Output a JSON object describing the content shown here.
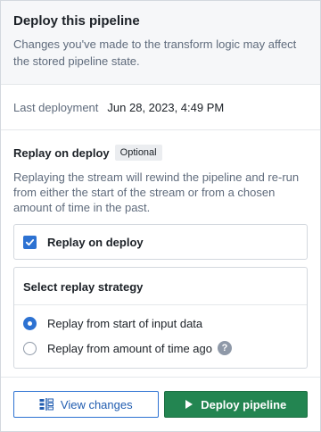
{
  "header": {
    "title": "Deploy this pipeline",
    "description": "Changes you've made to the transform logic may affect the stored pipeline state."
  },
  "last_deployment": {
    "label": "Last deployment",
    "value": "Jun 28, 2023, 4:49 PM"
  },
  "replay": {
    "title": "Replay on deploy",
    "tag": "Optional",
    "description": "Replaying the stream will rewind the pipeline and re-run from either the start of the stream or from a chosen amount of time in the past.",
    "checkbox_label": "Replay on deploy",
    "checked": true
  },
  "strategy": {
    "title": "Select replay strategy",
    "options": [
      {
        "label": "Replay from start of input data",
        "selected": true
      },
      {
        "label": "Replay from amount of time ago",
        "selected": false
      }
    ]
  },
  "footer": {
    "view_changes_label": "View changes",
    "deploy_label": "Deploy pipeline"
  },
  "colors": {
    "accent": "#2d72d2",
    "deploy_button": "#238551"
  }
}
